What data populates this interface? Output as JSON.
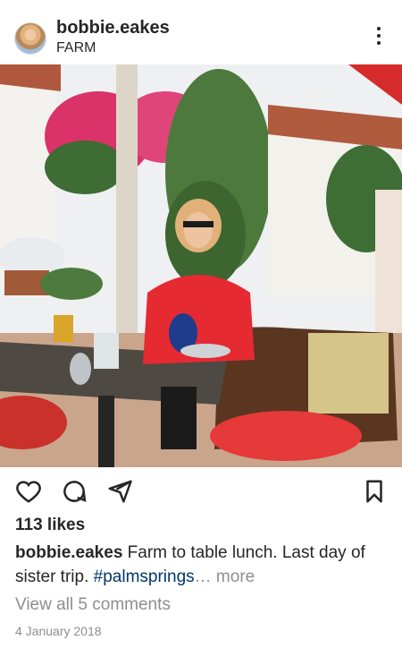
{
  "post": {
    "username": "bobbie.eakes",
    "location": "FARM",
    "likes": "113 likes",
    "caption_user": "bobbie.eakes",
    "caption_text": "Farm to table lunch. Last day of sister trip.",
    "hashtag": "#palmsprings",
    "ellipsis": "…",
    "more": "more",
    "view_comments": "View all 5 comments",
    "date": "4 January 2018"
  },
  "icons": {
    "menu": "more-vertical-icon",
    "like": "heart-icon",
    "comment": "comment-icon",
    "share": "send-icon",
    "save": "bookmark-icon"
  },
  "colors": {
    "text": "#262626",
    "secondary": "#8e8e8e",
    "hashtag": "#00376b",
    "background": "#ffffff"
  }
}
